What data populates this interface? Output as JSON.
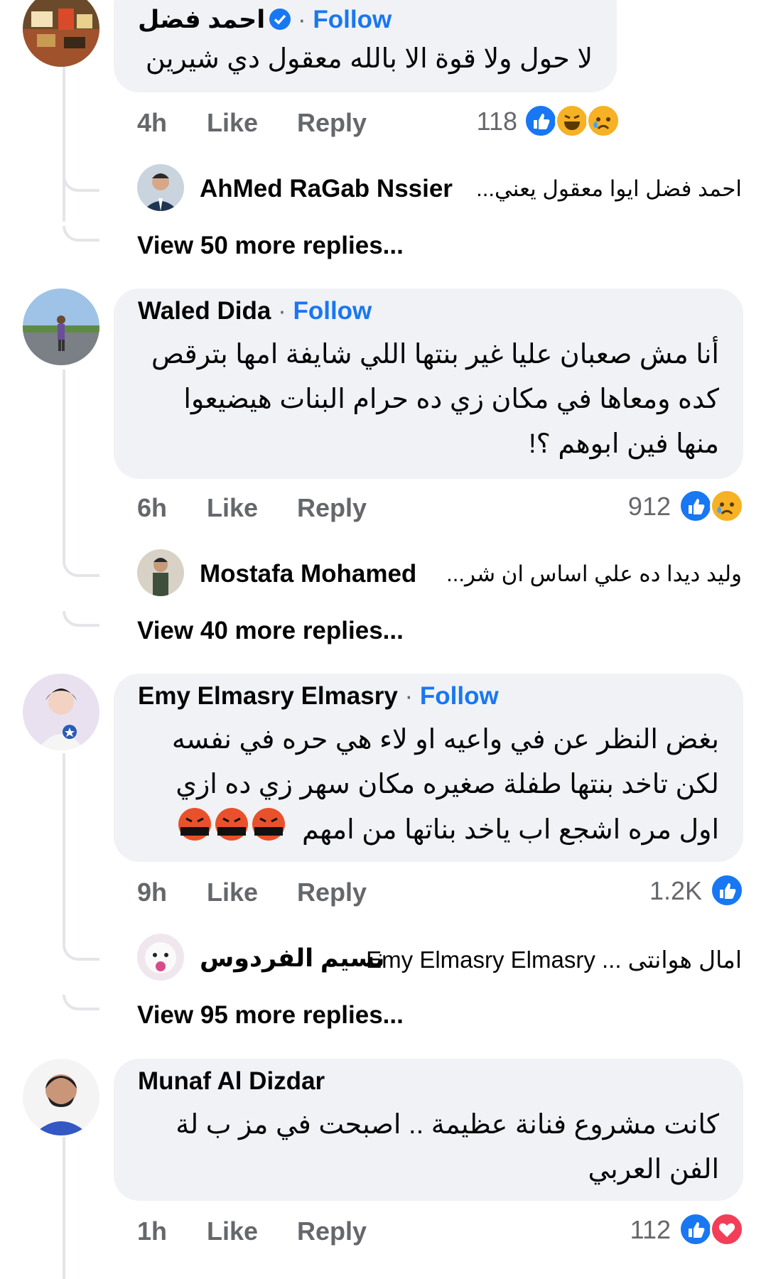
{
  "colors": {
    "accent": "#1877f2",
    "bubble": "#f0f2f5",
    "meta": "#65676b",
    "haha": "#f7b125",
    "love": "#f33e58"
  },
  "comments": [
    {
      "author": "احمد فضل",
      "verified": true,
      "follow": "Follow",
      "dot": "·",
      "lines": [
        "لا حول ولا قوة الا بالله معقول دي شيرين"
      ],
      "time": "4h",
      "like": "Like",
      "reply": "Reply",
      "count": "118",
      "reactions": [
        "like-icon",
        "haha-icon",
        "sad-icon"
      ],
      "reply_preview": {
        "name": "AhMed RaGab Nssier",
        "text": "احمد فضل ايوا معقول يعني..."
      },
      "more": "View 50 more replies..."
    },
    {
      "author": "Waled Dida",
      "follow": "Follow",
      "dot": "·",
      "lines": [
        "أنا مش صعبان عليا غير بنتها اللي شايفة امها بترقص",
        "كده ومعاها في مكان زي ده حرام البنات هيضيعوا",
        "منها فين ابوهم ؟!"
      ],
      "time": "6h",
      "like": "Like",
      "reply": "Reply",
      "count": "912",
      "reactions": [
        "like-icon",
        "sad-icon"
      ],
      "reply_preview": {
        "name": "Mostafa Mohamed",
        "text": "وليد ديدا ده علي اساس ان شر..."
      },
      "more": "View 40 more replies..."
    },
    {
      "author": "Emy Elmasry Elmasry",
      "follow": "Follow",
      "dot": "·",
      "lines": [
        "بغض النظر عن في واعيه او لاء هي حره في نفسه",
        "لكن تاخد بنتها طفلة صغيره مكان سهر زي ده ازي",
        "اول مره اشجع اب ياخد بناتها من امهم"
      ],
      "emoji_count": 3,
      "emoji_name": "cursing-face-icon",
      "time": "9h",
      "like": "Like",
      "reply": "Reply",
      "count": "1.2K",
      "reactions": [
        "like-icon"
      ],
      "reply_preview": {
        "name": "نسيم الفردوس",
        "text": "امال هوانتى ... Emy Elmasry Elmasry"
      },
      "more": "View 95 more replies..."
    },
    {
      "author": "Munaf Al Dizdar",
      "lines": [
        "كانت مشروع فنانة عظيمة .. اصبحت في مز ب لة",
        "الفن العربي"
      ],
      "time": "1h",
      "like": "Like",
      "reply": "Reply",
      "count": "112",
      "reactions": [
        "like-icon",
        "love-icon"
      ]
    }
  ]
}
